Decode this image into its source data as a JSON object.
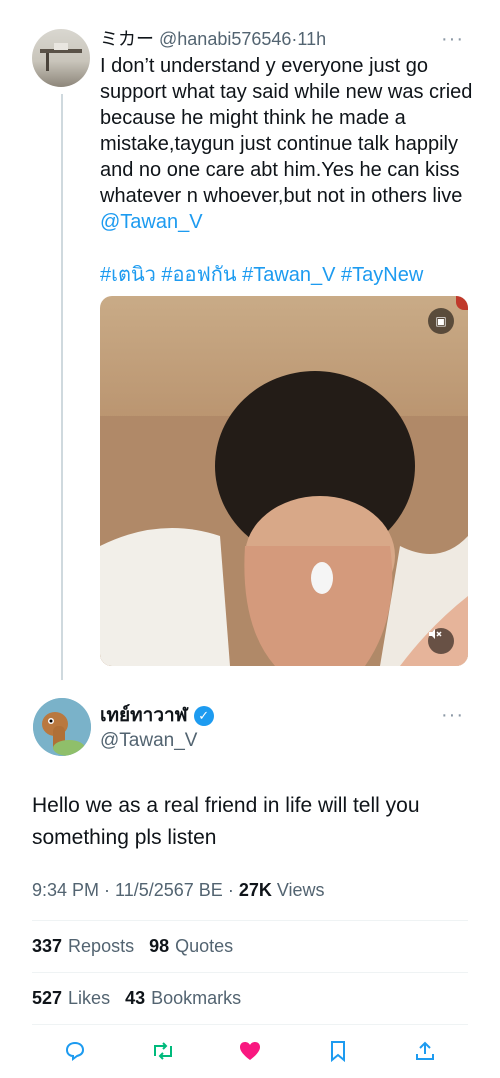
{
  "tweet1": {
    "display_name": "ミカー",
    "handle": "@hanabi576546",
    "time": "11h",
    "more": "···",
    "body": "I don’t understand y everyone just go support what tay said while new was cried because he might think he made a mistake,taygun just continue talk happily and no one care abt him.Yes he can kiss whatever n whoever,but not in others live ",
    "mention": "@Tawan_V",
    "hashtags": [
      "#เตนิว",
      "#ออฟกัน",
      "#Tawan_V",
      "#TayNew"
    ]
  },
  "tweet2": {
    "display_name": "เทย์ทาวาฬ",
    "handle": "@Tawan_V",
    "more": "···",
    "body": "Hello we as a real friend in life will tell you something pls listen",
    "time": "9:34 PM",
    "date": "11/5/2567 BE",
    "views_count": "27K",
    "views_label": "Views",
    "reposts_count": "337",
    "reposts_label": "Reposts",
    "quotes_count": "98",
    "quotes_label": "Quotes",
    "likes_count": "527",
    "likes_label": "Likes",
    "bookmarks_count": "43",
    "bookmarks_label": "Bookmarks"
  },
  "colors": {
    "accent": "#1d9bf0",
    "repost": "#00ba7c",
    "like": "#f91880",
    "muted": "#536471"
  },
  "icons": [
    "reply-icon",
    "repost-icon",
    "like-icon",
    "bookmark-icon",
    "share-icon",
    "verified-icon",
    "mute-icon",
    "tag-icon"
  ]
}
